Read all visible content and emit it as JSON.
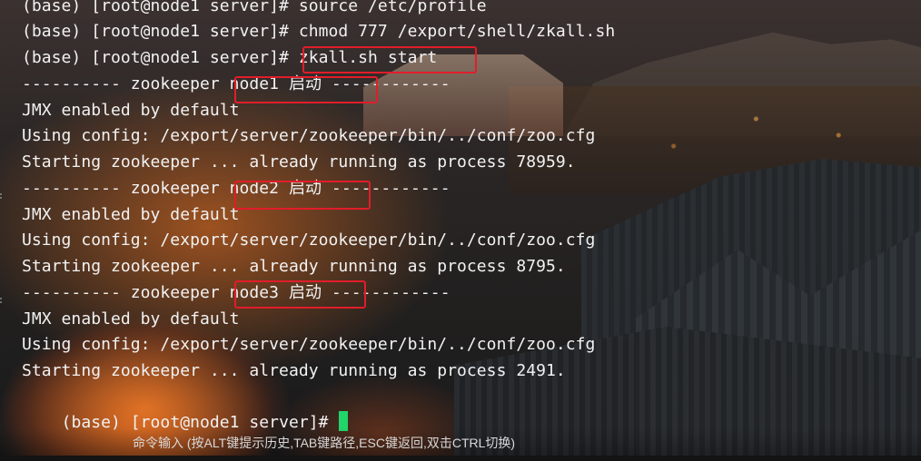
{
  "terminal": {
    "lines": [
      "(base) [root@node1 server]# source /etc/profile",
      "(base) [root@node1 server]# chmod 777 /export/shell/zkall.sh",
      "(base) [root@node1 server]# zkall.sh start",
      "---------- zookeeper node1 启动 ------------",
      "JMX enabled by default",
      "Using config: /export/server/zookeeper/bin/../conf/zoo.cfg",
      "Starting zookeeper ... already running as process 78959.",
      "---------- zookeeper node2 启动 ------------",
      "JMX enabled by default",
      "Using config: /export/server/zookeeper/bin/../conf/zoo.cfg",
      "Starting zookeeper ... already running as process 8795.",
      "---------- zookeeper node3 启动 ------------",
      "JMX enabled by default",
      "Using config: /export/server/zookeeper/bin/../conf/zoo.cfg",
      "Starting zookeeper ... already running as process 2491."
    ],
    "prompt": "(base) [root@node1 server]# ",
    "cursor_color": "#21d56a",
    "highlight_color": "#e11d2a"
  },
  "status_bar": {
    "hint": "命令输入 (按ALT键提示历史,TAB键路径,ESC键返回,双击CTRL切换)"
  },
  "icons": {
    "cursor": "block-cursor"
  }
}
